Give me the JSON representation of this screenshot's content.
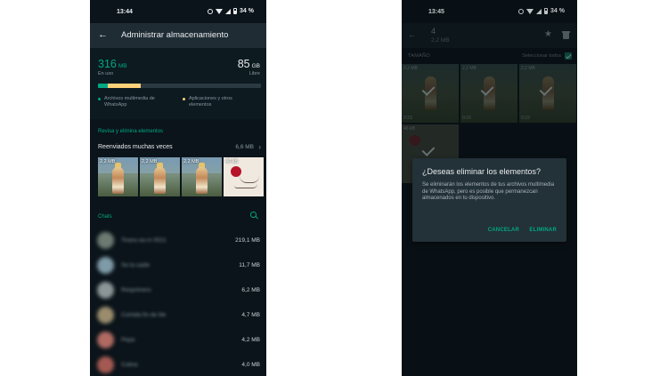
{
  "left_screen": {
    "status": {
      "time": "13:44",
      "battery": "34 %"
    },
    "header": {
      "title": "Administrar almacenamiento"
    },
    "storage": {
      "used_value": "316",
      "used_unit": "MB",
      "used_label": "En uso",
      "free_value": "85",
      "free_unit": "GB",
      "free_label": "Libre",
      "media_fraction": 0.06,
      "apps_fraction": 0.2,
      "legend_media": "Archivos multimedia de WhatsApp",
      "legend_apps": "Aplicaciones y otros elementos",
      "media_color": "#00a884",
      "apps_color": "#ffd279"
    },
    "review": {
      "section_title": "Revisa y elimina elementos",
      "forwarded_label": "Reenviados muchas veces",
      "forwarded_size": "6,6 MB",
      "thumbnails": [
        {
          "label": "2,2 MB",
          "kind": "photo"
        },
        {
          "label": "2,2 MB",
          "kind": "photo"
        },
        {
          "label": "2,2 MB",
          "kind": "photo"
        },
        {
          "label": "46 kB",
          "kind": "note"
        }
      ]
    },
    "chats": {
      "section_title": "Chats",
      "items": [
        {
          "name": "Tiranu ea m 0021",
          "size": "219,1 MB",
          "avatar_color": "#6d7a72"
        },
        {
          "name": "Se la cadie",
          "size": "11,7 MB",
          "avatar_color": "#7f9aa8"
        },
        {
          "name": "Resprimero",
          "size": "6,2 MB",
          "avatar_color": "#8c9598"
        },
        {
          "name": "Comida fin de tile",
          "size": "4,7 MB",
          "avatar_color": "#9a8c6c"
        },
        {
          "name": "Pepa",
          "size": "4,2 MB",
          "avatar_color": "#b06a62"
        },
        {
          "name": "Culina",
          "size": "4,0 MB",
          "avatar_color": "#a45a52"
        }
      ]
    }
  },
  "right_screen": {
    "status": {
      "time": "13:45",
      "battery": "34 %"
    },
    "selection": {
      "count": "4",
      "size": "2,2 MB"
    },
    "size_header": {
      "label": "TAMAÑO",
      "select_all": "Seleccionar todos"
    },
    "grid": [
      {
        "caption": "2,2 MB",
        "duration": "0:23",
        "kind": "photo",
        "checked": true
      },
      {
        "caption": "2,2 MB",
        "duration": "0:23",
        "kind": "photo",
        "checked": true
      },
      {
        "caption": "2,2 MB",
        "duration": "0:23",
        "kind": "photo",
        "checked": true
      },
      {
        "caption": "46 kB",
        "duration": "",
        "kind": "note",
        "checked": true
      }
    ],
    "dialog": {
      "title": "¿Deseas eliminar los elementos?",
      "body": "Se eliminarán los elementos de tus archivos multimedia de WhatsApp, pero es posible que permanezcan almacenados en tu dispositivo.",
      "cancel_label": "CANCELAR",
      "delete_label": "ELIMINAR"
    }
  },
  "icons": {
    "back": "arrow-left-icon",
    "chevron": "chevron-right-icon",
    "search": "search-icon",
    "star": "star-icon",
    "trash": "trash-icon",
    "checkbox": "checkbox-icon"
  }
}
